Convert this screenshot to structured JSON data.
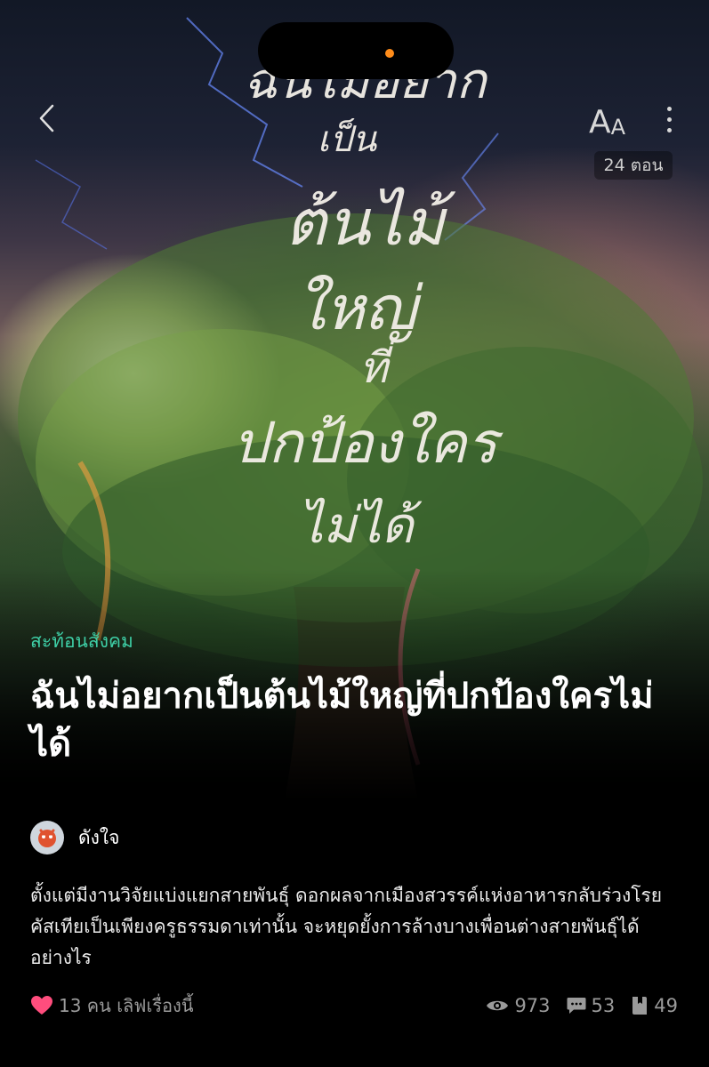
{
  "header": {
    "font_button_big": "A",
    "font_button_small": "A",
    "episode_count": "24 ตอน"
  },
  "cover": {
    "artwork_title_lines": [
      "ฉันไม่อยาก",
      "เป็น",
      "ต้นไม้",
      "ใหญ่",
      "ที่",
      "ปกป้องใคร",
      "ไม่ได้"
    ]
  },
  "story": {
    "category": "สะท้อนสังคม",
    "title": "ฉันไม่อยากเป็นต้นไม้ใหญ่ที่ปกป้องใครไม่ได้",
    "author": "ดังใจ",
    "synopsis": "ตั้งแต่มีงานวิจัยแบ่งแยกสายพันธุ์ ดอกผลจากเมืองสวรรค์แห่งอาหารกลับร่วงโรย คัสเทียเป็นเพียงครูธรรมดาเท่านั้น จะหยุดยั้งการล้างบางเพื่อนต่างสายพันธุ์ได้อย่างไร"
  },
  "footer": {
    "love_text": "13 คน เลิฟเรื่องนี้",
    "views": "973",
    "comments": "53",
    "bookmarks": "49"
  },
  "colors": {
    "category": "#3ecfa6",
    "heart": "#ff4d7d",
    "notch_dot": "#ff8c1a"
  }
}
